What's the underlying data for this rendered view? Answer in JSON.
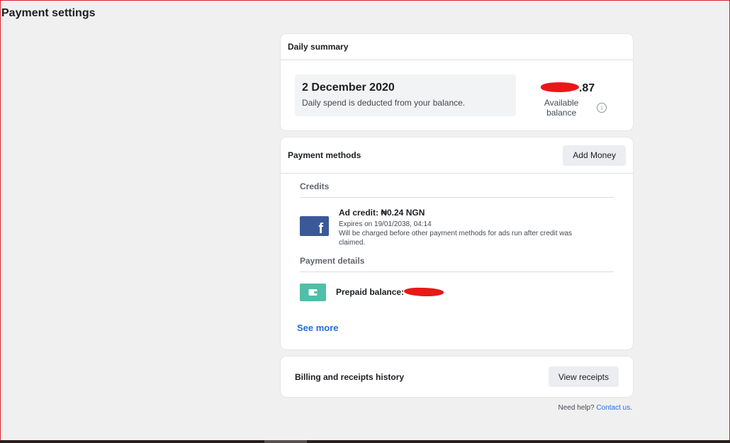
{
  "page": {
    "title": "Payment settings"
  },
  "daily_summary": {
    "header": "Daily summary",
    "date": "2 December 2020",
    "description": "Daily spend is deducted from your balance.",
    "balance_suffix": ".87",
    "balance_label": "Available balance",
    "info_icon": "info-icon"
  },
  "payment_methods": {
    "header": "Payment methods",
    "add_money_label": "Add Money",
    "credits": {
      "title": "Credits",
      "item_title": "Ad credit: ₦0.24 NGN",
      "expires": "Expires on 19/01/2038, 04:14",
      "note": "Will be charged before other payment methods for ads run after credit was claimed."
    },
    "details": {
      "title": "Payment details",
      "prepaid_label": "Prepaid balance:"
    },
    "see_more_label": "See more"
  },
  "billing": {
    "title": "Billing and receipts history",
    "view_receipts_label": "View receipts"
  },
  "help": {
    "prefix": "Need help?",
    "link": "Contact us",
    "suffix": "."
  },
  "colors": {
    "accent": "#216fdb",
    "facebook": "#3b5998",
    "wallet": "#4fbfa8",
    "redaction": "#e91818"
  }
}
